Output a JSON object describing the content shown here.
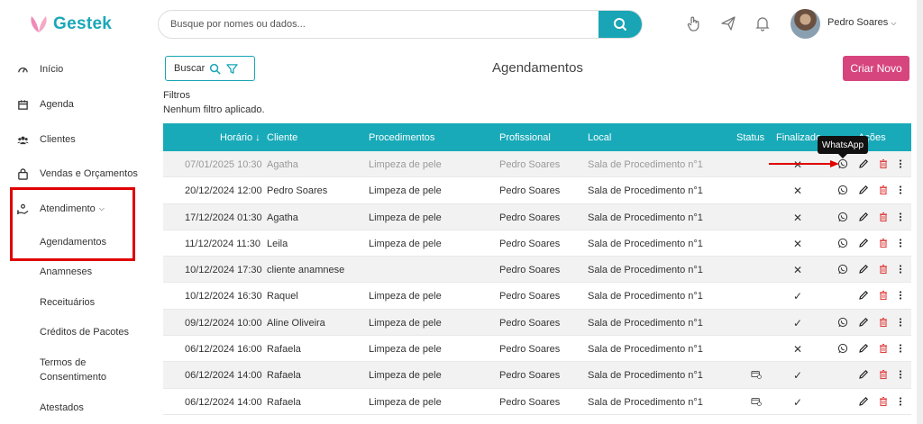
{
  "app": {
    "name": "Gestek"
  },
  "sidebar": {
    "items": [
      {
        "label": "Início",
        "icon": "dashboard-icon"
      },
      {
        "label": "Agenda",
        "icon": "calendar-icon"
      },
      {
        "label": "Clientes",
        "icon": "users-icon"
      },
      {
        "label": "Vendas e Orçamentos",
        "icon": "bag-icon"
      },
      {
        "label": "Atendimento",
        "icon": "hand-icon",
        "expanded": true
      }
    ],
    "subitems": [
      {
        "label": "Agendamentos"
      },
      {
        "label": "Anamneses"
      },
      {
        "label": "Receituários"
      },
      {
        "label": "Créditos de Pacotes"
      },
      {
        "label": "Termos de Consentimento"
      },
      {
        "label": "Atestados"
      }
    ]
  },
  "header": {
    "search_placeholder": "Busque por nomes ou dados...",
    "user_name": "Pedro Soares"
  },
  "main": {
    "buscar_label": "Buscar",
    "title": "Agendamentos",
    "criar_label": "Criar Novo",
    "filtros_label": "Filtros",
    "filtros_status": "Nenhum filtro aplicado.",
    "tooltip": "WhatsApp"
  },
  "table": {
    "columns": [
      "Horário",
      "Cliente",
      "Procedimentos",
      "Profissional",
      "Local",
      "Status",
      "Finalizado",
      "Ações"
    ],
    "rows": [
      {
        "horario": "07/01/2025 10:30",
        "cliente": "Agatha",
        "procedimentos": "Limpeza de pele",
        "profissional": "Pedro Soares",
        "local": "Sala de Procedimento n°1",
        "status": "",
        "finalizado": "x",
        "whatsapp": true
      },
      {
        "horario": "20/12/2024 12:00",
        "cliente": "Pedro Soares",
        "procedimentos": "Limpeza de pele",
        "profissional": "Pedro Soares",
        "local": "Sala de Procedimento n°1",
        "status": "",
        "finalizado": "x",
        "whatsapp": true
      },
      {
        "horario": "17/12/2024 01:30",
        "cliente": "Agatha",
        "procedimentos": "Limpeza de pele",
        "profissional": "Pedro Soares",
        "local": "Sala de Procedimento n°1",
        "status": "",
        "finalizado": "x",
        "whatsapp": true
      },
      {
        "horario": "11/12/2024 11:30",
        "cliente": "Leila",
        "procedimentos": "Limpeza de pele",
        "profissional": "Pedro Soares",
        "local": "Sala de Procedimento n°1",
        "status": "",
        "finalizado": "x",
        "whatsapp": true
      },
      {
        "horario": "10/12/2024 17:30",
        "cliente": "cliente anamnese",
        "procedimentos": "",
        "profissional": "Pedro Soares",
        "local": "Sala de Procedimento n°1",
        "status": "",
        "finalizado": "x",
        "whatsapp": true
      },
      {
        "horario": "10/12/2024 16:30",
        "cliente": "Raquel",
        "procedimentos": "Limpeza de pele",
        "profissional": "Pedro Soares",
        "local": "Sala de Procedimento n°1",
        "status": "",
        "finalizado": "check",
        "whatsapp": false
      },
      {
        "horario": "09/12/2024 10:00",
        "cliente": "Aline Oliveira",
        "procedimentos": "Limpeza de pele",
        "profissional": "Pedro Soares",
        "local": "Sala de Procedimento n°1",
        "status": "",
        "finalizado": "check",
        "whatsapp": true
      },
      {
        "horario": "06/12/2024 16:00",
        "cliente": "Rafaela",
        "procedimentos": "Limpeza de pele",
        "profissional": "Pedro Soares",
        "local": "Sala de Procedimento n°1",
        "status": "",
        "finalizado": "x",
        "whatsapp": true
      },
      {
        "horario": "06/12/2024 14:00",
        "cliente": "Rafaela",
        "procedimentos": "Limpeza de pele",
        "profissional": "Pedro Soares",
        "local": "Sala de Procedimento n°1",
        "status": "payment-icon",
        "finalizado": "check",
        "whatsapp": false
      },
      {
        "horario": "06/12/2024 14:00",
        "cliente": "Rafaela",
        "procedimentos": "Limpeza de pele",
        "profissional": "Pedro Soares",
        "local": "Sala de Procedimento n°1",
        "status": "payment-icon",
        "finalizado": "check",
        "whatsapp": false
      }
    ]
  },
  "colors": {
    "accent": "#19aab9",
    "primary_button": "#d6457e",
    "delete": "#e04040",
    "highlight": "#e00000"
  }
}
